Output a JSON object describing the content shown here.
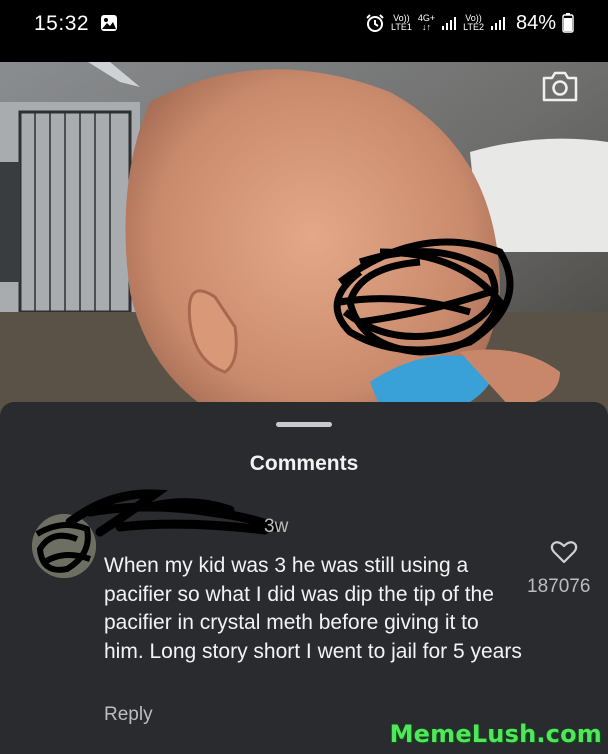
{
  "status_bar": {
    "time": "15:32",
    "sim1_line1": "Vo))",
    "sim1_line2": "LTE1",
    "network_type": "4G+",
    "sim2_line1": "Vo))",
    "sim2_line2": "LTE2",
    "battery": "84%",
    "battery_level": 0.84
  },
  "photo": {
    "camera_icon": "camera-icon"
  },
  "comments_sheet": {
    "title": "Comments",
    "comment": {
      "age": "3w",
      "text": "When my kid was 3 he was still using a pacifier so what I did was dip the tip of the pacifier in crystal meth before giving it to him. Long story short I went to jail for 5 years",
      "reply_label": "Reply",
      "like_icon": "heart-icon",
      "like_count": "187076"
    }
  },
  "watermark": "MemeLush.com"
}
